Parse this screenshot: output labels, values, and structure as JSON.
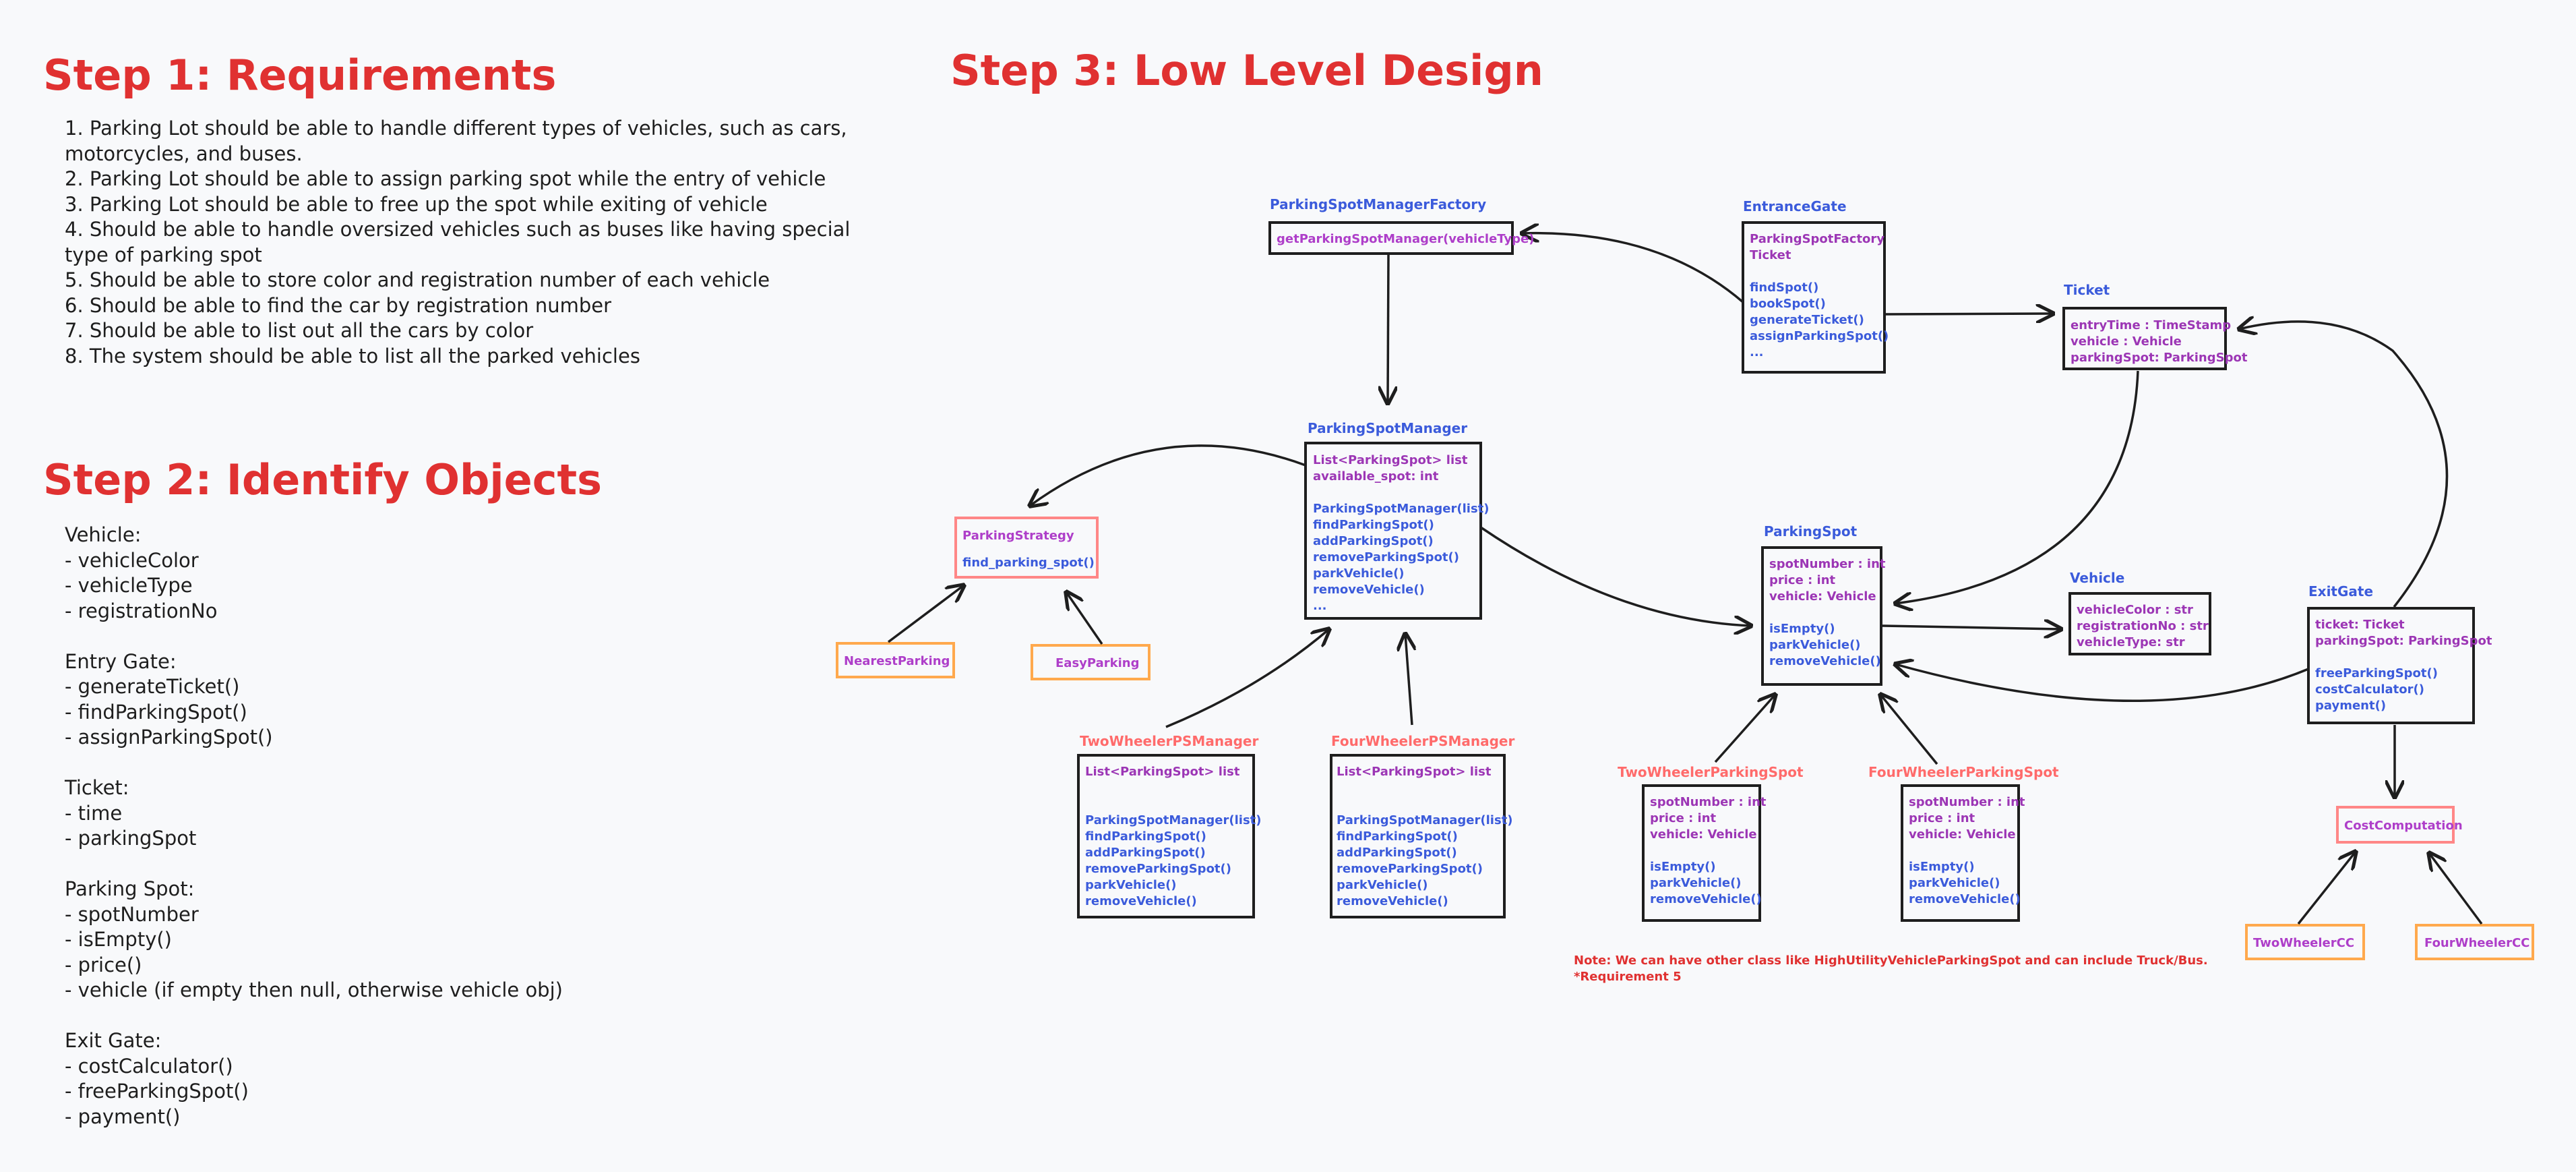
{
  "headings": {
    "step1": "Step 1: Requirements",
    "step2": "Step 2: Identify Objects",
    "step3": "Step 3: Low Level Design"
  },
  "requirements": [
    "1. Parking Lot should be able to handle different types of vehicles, such as cars, motorcycles, and buses.",
    "2. Parking Lot should be able to assign parking spot while the entry of vehicle",
    "3. Parking Lot should be able to free up the spot while exiting of vehicle",
    "4. Should be able to handle oversized vehicles such as buses like having special type of parking spot",
    "5. Should be able to store color and registration number of each vehicle",
    "6. Should be able to find the car by registration number",
    "7. Should be able to list out all the cars by color",
    "8. The system should be able to list all the parked vehicles"
  ],
  "objects": [
    {
      "title": "Vehicle:",
      "items": [
        "- vehicleColor",
        "- vehicleType",
        "- registrationNo"
      ]
    },
    {
      "title": "Entry Gate:",
      "items": [
        "- generateTicket()",
        "- findParkingSpot()",
        "- assignParkingSpot()"
      ]
    },
    {
      "title": "Ticket:",
      "items": [
        "- time",
        "- parkingSpot"
      ]
    },
    {
      "title": "Parking Spot:",
      "items": [
        "- spotNumber",
        "- isEmpty()",
        "- price()",
        "- vehicle (if empty then null, otherwise vehicle obj)"
      ]
    },
    {
      "title": "Exit Gate:",
      "items": [
        "- costCalculator()",
        "- freeParkingSpot()",
        "- payment()"
      ]
    }
  ],
  "diagram": {
    "factory": {
      "title": "ParkingSpotManagerFactory",
      "method": "getParkingSpotManager(vehicleType)"
    },
    "entrance": {
      "title": "EntranceGate",
      "fields": [
        "ParkingSpotFactory",
        "Ticket"
      ],
      "methods": [
        "findSpot()",
        "bookSpot()",
        "generateTicket()",
        "assignParkingSpot()",
        "..."
      ]
    },
    "ticket": {
      "title": "Ticket",
      "fields": [
        "entryTime : TimeStamp",
        "vehicle : Vehicle",
        "parkingSpot: ParkingSpot"
      ]
    },
    "manager": {
      "title": "ParkingSpotManager",
      "fields": [
        "List<ParkingSpot> list",
        "available_spot: int"
      ],
      "methods": [
        "ParkingSpotManager(list)",
        "findParkingSpot()",
        "addParkingSpot()",
        "removeParkingSpot()",
        "parkVehicle()",
        "removeVehicle()",
        "..."
      ]
    },
    "strategy": {
      "title": "ParkingStrategy",
      "method": "find_parking_spot()"
    },
    "nearest": "NearestParking",
    "easy": "EasyParking",
    "twoPS": {
      "title": "TwoWheelerPSManager",
      "fields": [
        "List<ParkingSpot> list"
      ],
      "methods": [
        "ParkingSpotManager(list)",
        "findParkingSpot()",
        "addParkingSpot()",
        "removeParkingSpot()",
        "parkVehicle()",
        "removeVehicle()"
      ]
    },
    "fourPS": {
      "title": "FourWheelerPSManager",
      "fields": [
        "List<ParkingSpot> list"
      ],
      "methods": [
        "ParkingSpotManager(list)",
        "findParkingSpot()",
        "addParkingSpot()",
        "removeParkingSpot()",
        "parkVehicle()",
        "removeVehicle()"
      ]
    },
    "spot": {
      "title": "ParkingSpot",
      "fields": [
        "spotNumber : int",
        "price : int",
        "vehicle: Vehicle"
      ],
      "methods": [
        "isEmpty()",
        "parkVehicle()",
        "removeVehicle()"
      ]
    },
    "vehicle": {
      "title": "Vehicle",
      "fields": [
        "vehicleColor : str",
        "registrationNo : str",
        "vehicleType: str"
      ]
    },
    "exit": {
      "title": "ExitGate",
      "fields": [
        "ticket: Ticket",
        "parkingSpot: ParkingSpot"
      ],
      "methods": [
        "freeParkingSpot()",
        "costCalculator()",
        "payment()"
      ]
    },
    "twoSpot": {
      "title": "TwoWheelerParkingSpot",
      "fields": [
        "spotNumber : int",
        "price : int",
        "vehicle: Vehicle"
      ],
      "methods": [
        "isEmpty()",
        "parkVehicle()",
        "removeVehicle()"
      ]
    },
    "fourSpot": {
      "title": "FourWheelerParkingSpot",
      "fields": [
        "spotNumber : int",
        "price : int",
        "vehicle: Vehicle"
      ],
      "methods": [
        "isEmpty()",
        "parkVehicle()",
        "removeVehicle()"
      ]
    },
    "cost": "CostComputation",
    "twoCC": "TwoWheelerCC",
    "fourCC": "FourWheelerCC",
    "note": [
      "Note: We can have other class like HighUtilityVehicleParkingSpot and can include Truck/Bus.",
      "*Requirement 5"
    ]
  }
}
